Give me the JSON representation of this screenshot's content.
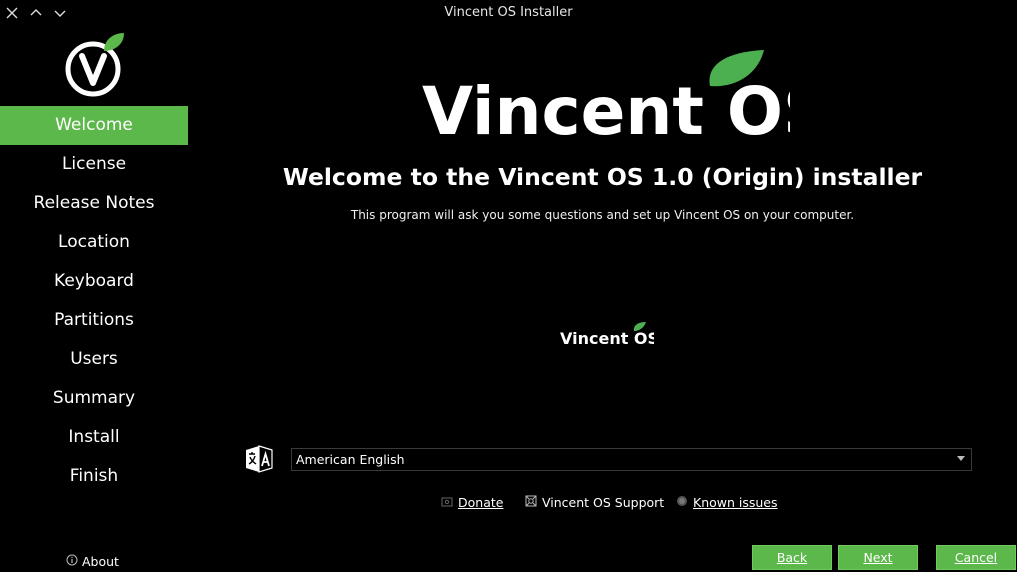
{
  "window": {
    "title": "Vincent OS Installer"
  },
  "sidebar": {
    "items": [
      {
        "label": "Welcome",
        "active": true
      },
      {
        "label": "License"
      },
      {
        "label": "Release Notes"
      },
      {
        "label": "Location"
      },
      {
        "label": "Keyboard"
      },
      {
        "label": "Partitions"
      },
      {
        "label": "Users"
      },
      {
        "label": "Summary"
      },
      {
        "label": "Install"
      },
      {
        "label": "Finish"
      }
    ],
    "about_label": "About"
  },
  "main": {
    "logo_text": "Vincent OS",
    "title": "Welcome to the Vincent OS 1.0 (Origin) installer",
    "subtitle": "This program will ask you some questions and set up Vincent OS on your computer.",
    "small_logo_text": "Vincent OS",
    "language": {
      "selected": "American English"
    },
    "links": {
      "donate": "Donate",
      "support": "Vincent OS Support",
      "known_issues": "Known issues"
    },
    "buttons": {
      "back": "Back",
      "next": "Next",
      "cancel": "Cancel"
    }
  },
  "colors": {
    "accent": "#5cb84a",
    "background": "#000000",
    "leaf": "#4caf50"
  },
  "icons": {
    "close": "close-icon",
    "maximize": "chevron-up-icon",
    "minimize": "chevron-down-icon",
    "about": "info-icon",
    "language": "translate-icon",
    "donate": "donate-icon",
    "support": "support-icon",
    "known_issues": "bug-icon"
  }
}
